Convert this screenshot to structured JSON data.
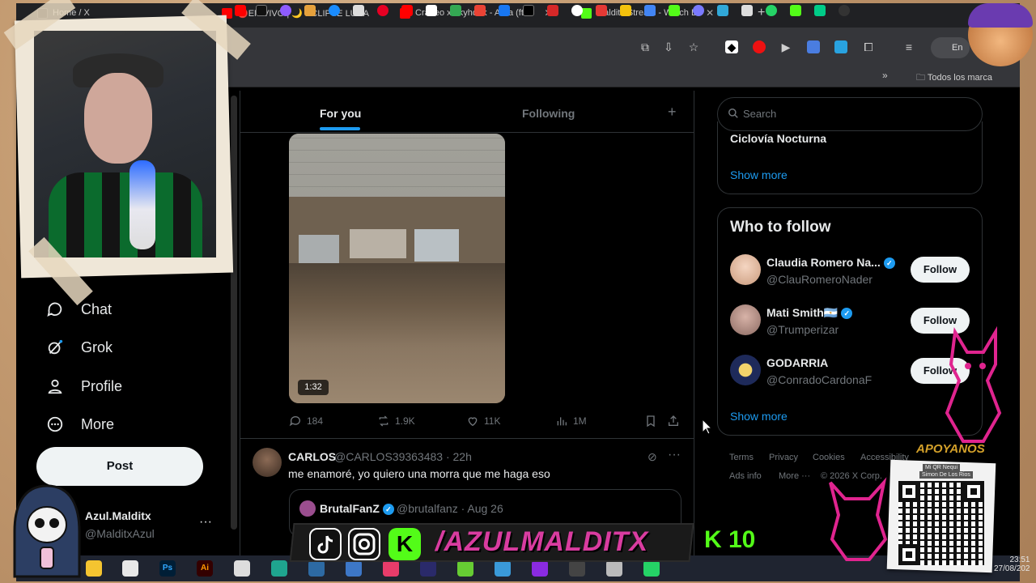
{
  "browser": {
    "tabs": [
      {
        "title": "Home / X",
        "favicon": "x-logo-icon",
        "color": "#000000"
      },
      {
        "title": "🔴EN VIVO | 🌙 ECLIPSE LUNA",
        "favicon": "youtube-icon",
        "color": "#ff0000"
      },
      {
        "title": "Cráneo x $kyhook - Aura (ft. B",
        "favicon": "youtube-icon",
        "color": "#ff0000"
      },
      {
        "title": "...alditx Stream - Watch L",
        "favicon": "kick-icon",
        "color": "#53fc18"
      }
    ],
    "new_tab": "+",
    "profile_label": "En p",
    "bookmarks_folder": "Todos los marca"
  },
  "feed": {
    "tab_for_you": "For you",
    "tab_following": "Following",
    "tab_add": "+",
    "video_duration": "1:32",
    "actions": {
      "replies": "184",
      "reposts": "1.9K",
      "likes": "11K",
      "views": "1M"
    },
    "tweet2": {
      "name": "CARLOS",
      "handle_time": "@CARLOS39363483 · 22h",
      "text": "me enamoré,  yo quiero una morra que me haga eso",
      "quote_name": "BrutalFanZ",
      "quote_handle_time": "@brutalfanz · Aug 26"
    }
  },
  "nav": {
    "items": [
      {
        "label": "Chat",
        "icon": "chat-bubble-icon"
      },
      {
        "label": "Grok",
        "icon": "grok-icon"
      },
      {
        "label": "Profile",
        "icon": "person-icon"
      },
      {
        "label": "More",
        "icon": "more-circle-icon"
      }
    ],
    "post_label": "Post",
    "account_name": "Azul.Malditx",
    "account_handle": "@MalditxAzul",
    "account_more": "···"
  },
  "sidebar": {
    "search_placeholder": "Search",
    "trend": "Ciclovía Nocturna",
    "trends_show_more": "Show more",
    "who_to_follow_title": "Who to follow",
    "suggestions": [
      {
        "name": "Claudia Romero Na...",
        "handle": "@ClauRomeroNader",
        "verified": true,
        "follow": "Follow"
      },
      {
        "name": "Mati Smith🇦🇷",
        "handle": "@Trumperizar",
        "verified": true,
        "follow": "Follow"
      },
      {
        "name": "GODARRIA",
        "handle": "@ConradoCardonaF",
        "verified": false,
        "follow": "Follow"
      }
    ],
    "follow_show_more": "Show more",
    "footer": {
      "terms": "Terms",
      "privacy": "Privacy",
      "cookies": "Cookies",
      "accessibility": "Accessibility",
      "ads": "Ads info",
      "more": "More ···",
      "copyright": "© 2026 X Corp."
    }
  },
  "overlay": {
    "brand": "/AZULMALDITX",
    "kick_level": "K 10",
    "support_title": "APOYANOS",
    "qr_caption": "Mi QR Nequi",
    "qr_caption_name": "Simon De Los Rios"
  },
  "taskbar": {
    "time": "23:51",
    "date": "27/08/202"
  },
  "colors": {
    "accent": "#1d9bf0",
    "brand_pink": "#d93ca0",
    "kick_green": "#53fc18"
  }
}
